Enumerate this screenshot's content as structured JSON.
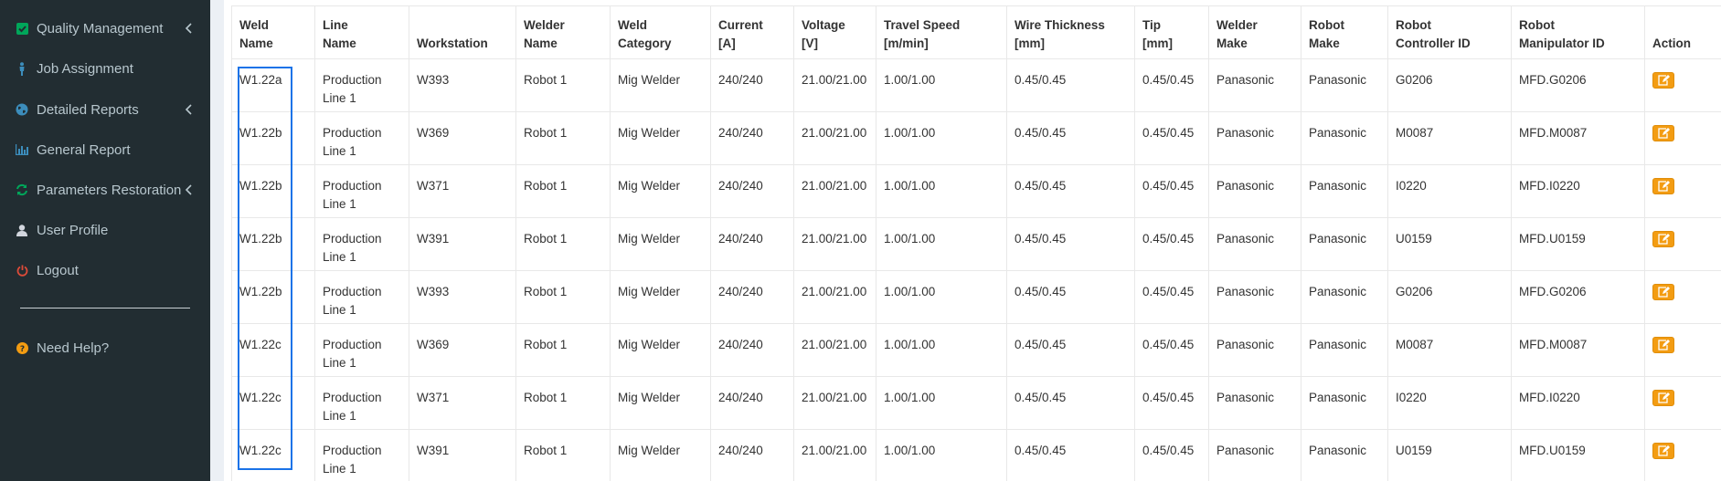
{
  "sidebar": {
    "items": [
      {
        "label": "Quality Management",
        "icon": "check-square-icon",
        "has_chevron": true
      },
      {
        "label": "Job Assignment",
        "icon": "person-icon",
        "has_chevron": false
      },
      {
        "label": "Detailed Reports",
        "icon": "globe-icon",
        "has_chevron": true
      },
      {
        "label": "General Report",
        "icon": "bar-chart-icon",
        "has_chevron": false
      },
      {
        "label": "Parameters Restoration",
        "icon": "refresh-icon",
        "has_chevron": true
      },
      {
        "label": "User Profile",
        "icon": "user-icon",
        "has_chevron": false
      },
      {
        "label": "Logout",
        "icon": "power-icon",
        "has_chevron": false
      }
    ],
    "help": {
      "label": "Need Help?",
      "icon": "question-icon"
    }
  },
  "colors": {
    "sidebar_bg": "#222d32",
    "sidebar_text": "#b8c7ce",
    "green_icon": "#00a65a",
    "blue_icon": "#3c8dbc",
    "red_icon": "#dd4b39",
    "orange_icon": "#f39c12",
    "edit_button": "#f39c12",
    "highlight_border": "#1a73e8"
  },
  "table": {
    "headers": [
      [
        "Weld",
        "Name"
      ],
      [
        "Line",
        "Name"
      ],
      [
        "",
        "Workstation"
      ],
      [
        "Welder",
        "Name"
      ],
      [
        "Weld",
        "Category"
      ],
      [
        "Current",
        "[A]"
      ],
      [
        "Voltage",
        "[V]"
      ],
      [
        "Travel Speed",
        "[m/min]"
      ],
      [
        "Wire Thickness",
        "[mm]"
      ],
      [
        "Tip",
        "[mm]"
      ],
      [
        "Welder",
        "Make"
      ],
      [
        "Robot",
        "Make"
      ],
      [
        "Robot",
        "Controller ID"
      ],
      [
        "Robot",
        "Manipulator ID"
      ],
      [
        "",
        "Action"
      ]
    ],
    "rows": [
      [
        [
          "W1.22a"
        ],
        [
          "Production",
          "Line 1"
        ],
        [
          "W393"
        ],
        [
          "Robot 1"
        ],
        [
          "Mig Welder"
        ],
        [
          "240/240"
        ],
        [
          "21.00/21.00"
        ],
        [
          "1.00/1.00"
        ],
        [
          "0.45/0.45"
        ],
        [
          "0.45/0.45"
        ],
        [
          "Panasonic"
        ],
        [
          "Panasonic"
        ],
        [
          "G0206"
        ],
        [
          "MFD.G0206"
        ]
      ],
      [
        [
          "W1.22b"
        ],
        [
          "Production",
          "Line 1"
        ],
        [
          "W369"
        ],
        [
          "Robot 1"
        ],
        [
          "Mig Welder"
        ],
        [
          "240/240"
        ],
        [
          "21.00/21.00"
        ],
        [
          "1.00/1.00"
        ],
        [
          "0.45/0.45"
        ],
        [
          "0.45/0.45"
        ],
        [
          "Panasonic"
        ],
        [
          "Panasonic"
        ],
        [
          "M0087"
        ],
        [
          "MFD.M0087"
        ]
      ],
      [
        [
          "W1.22b"
        ],
        [
          "Production",
          "Line 1"
        ],
        [
          "W371"
        ],
        [
          "Robot 1"
        ],
        [
          "Mig Welder"
        ],
        [
          "240/240"
        ],
        [
          "21.00/21.00"
        ],
        [
          "1.00/1.00"
        ],
        [
          "0.45/0.45"
        ],
        [
          "0.45/0.45"
        ],
        [
          "Panasonic"
        ],
        [
          "Panasonic"
        ],
        [
          "I0220"
        ],
        [
          "MFD.I0220"
        ]
      ],
      [
        [
          "W1.22b"
        ],
        [
          "Production",
          "Line 1"
        ],
        [
          "W391"
        ],
        [
          "Robot 1"
        ],
        [
          "Mig Welder"
        ],
        [
          "240/240"
        ],
        [
          "21.00/21.00"
        ],
        [
          "1.00/1.00"
        ],
        [
          "0.45/0.45"
        ],
        [
          "0.45/0.45"
        ],
        [
          "Panasonic"
        ],
        [
          "Panasonic"
        ],
        [
          "U0159"
        ],
        [
          "MFD.U0159"
        ]
      ],
      [
        [
          "W1.22b"
        ],
        [
          "Production",
          "Line 1"
        ],
        [
          "W393"
        ],
        [
          "Robot 1"
        ],
        [
          "Mig Welder"
        ],
        [
          "240/240"
        ],
        [
          "21.00/21.00"
        ],
        [
          "1.00/1.00"
        ],
        [
          "0.45/0.45"
        ],
        [
          "0.45/0.45"
        ],
        [
          "Panasonic"
        ],
        [
          "Panasonic"
        ],
        [
          "G0206"
        ],
        [
          "MFD.G0206"
        ]
      ],
      [
        [
          "W1.22c"
        ],
        [
          "Production",
          "Line 1"
        ],
        [
          "W369"
        ],
        [
          "Robot 1"
        ],
        [
          "Mig Welder"
        ],
        [
          "240/240"
        ],
        [
          "21.00/21.00"
        ],
        [
          "1.00/1.00"
        ],
        [
          "0.45/0.45"
        ],
        [
          "0.45/0.45"
        ],
        [
          "Panasonic"
        ],
        [
          "Panasonic"
        ],
        [
          "M0087"
        ],
        [
          "MFD.M0087"
        ]
      ],
      [
        [
          "W1.22c"
        ],
        [
          "Production",
          "Line 1"
        ],
        [
          "W371"
        ],
        [
          "Robot 1"
        ],
        [
          "Mig Welder"
        ],
        [
          "240/240"
        ],
        [
          "21.00/21.00"
        ],
        [
          "1.00/1.00"
        ],
        [
          "0.45/0.45"
        ],
        [
          "0.45/0.45"
        ],
        [
          "Panasonic"
        ],
        [
          "Panasonic"
        ],
        [
          "I0220"
        ],
        [
          "MFD.I0220"
        ]
      ],
      [
        [
          "W1.22c"
        ],
        [
          "Production",
          "Line 1"
        ],
        [
          "W391"
        ],
        [
          "Robot 1"
        ],
        [
          "Mig Welder"
        ],
        [
          "240/240"
        ],
        [
          "21.00/21.00"
        ],
        [
          "1.00/1.00"
        ],
        [
          "0.45/0.45"
        ],
        [
          "0.45/0.45"
        ],
        [
          "Panasonic"
        ],
        [
          "Panasonic"
        ],
        [
          "U0159"
        ],
        [
          "MFD.U0159"
        ]
      ]
    ],
    "action_icon": "edit-icon"
  }
}
